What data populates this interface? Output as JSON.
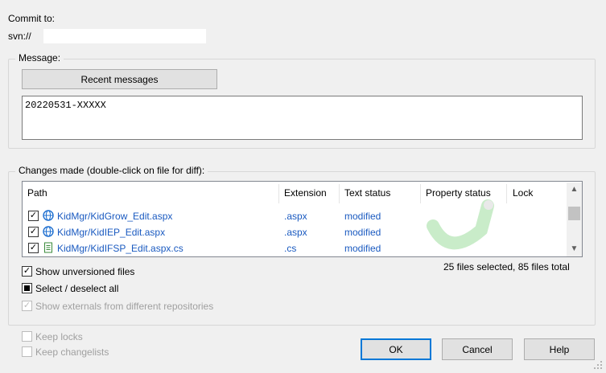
{
  "commit": {
    "label": "Commit to:",
    "url": "svn://"
  },
  "message": {
    "group_title": "Message:",
    "recent_button": "Recent messages",
    "text": "20220531-XXXXX"
  },
  "changes": {
    "group_title": "Changes made (double-click on file for diff):",
    "columns": [
      "Path",
      "Extension",
      "Text status",
      "Property status",
      "Lock"
    ],
    "files": [
      {
        "path": "KidMgr/KidGrow_Edit.aspx",
        "extension": ".aspx",
        "text_status": "modified",
        "icon": "globe-icon",
        "checked": true
      },
      {
        "path": "KidMgr/KidIEP_Edit.aspx",
        "extension": ".aspx",
        "text_status": "modified",
        "icon": "globe-icon",
        "checked": true
      },
      {
        "path": "KidMgr/KidIFSP_Edit.aspx.cs",
        "extension": ".cs",
        "text_status": "modified",
        "icon": "document-icon",
        "checked": true
      }
    ],
    "summary": "25 files selected, 85 files total"
  },
  "options": {
    "show_unversioned": {
      "label": "Show unversioned files",
      "checked": true
    },
    "select_all": {
      "label": "Select / deselect all",
      "state": "indeterminate"
    },
    "show_externals": {
      "label": "Show externals from different repositories",
      "checked": true,
      "disabled": true
    },
    "keep_locks": {
      "label": "Keep locks",
      "checked": false,
      "disabled": true
    },
    "keep_changelists": {
      "label": "Keep changelists",
      "checked": false,
      "disabled": true
    }
  },
  "buttons": {
    "ok": "OK",
    "cancel": "Cancel",
    "help": "Help"
  },
  "colors": {
    "window_bg": "#f0f0f0",
    "file_link": "#1a5ac0",
    "ok_border": "#0078d7"
  }
}
